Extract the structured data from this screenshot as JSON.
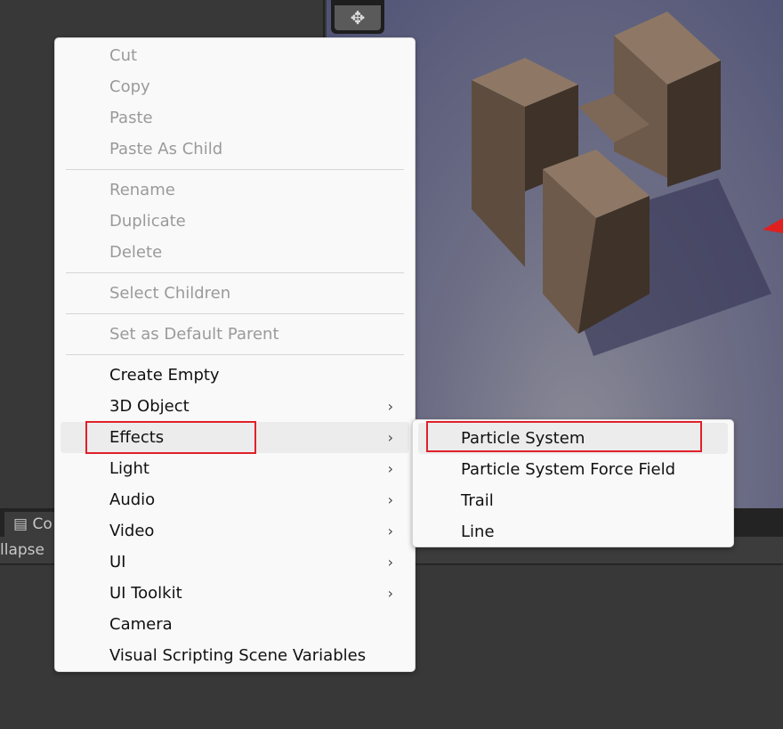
{
  "bottom_panel": {
    "tab_label": "Co",
    "toolbar_text": "llapse"
  },
  "context_menu": {
    "groups": [
      [
        {
          "label": "Cut",
          "enabled": false
        },
        {
          "label": "Copy",
          "enabled": false
        },
        {
          "label": "Paste",
          "enabled": false
        },
        {
          "label": "Paste As Child",
          "enabled": false
        }
      ],
      [
        {
          "label": "Rename",
          "enabled": false
        },
        {
          "label": "Duplicate",
          "enabled": false
        },
        {
          "label": "Delete",
          "enabled": false
        }
      ],
      [
        {
          "label": "Select Children",
          "enabled": false
        }
      ],
      [
        {
          "label": "Set as Default Parent",
          "enabled": false
        }
      ],
      [
        {
          "label": "Create Empty",
          "enabled": true
        },
        {
          "label": "3D Object",
          "enabled": true,
          "submenu": true
        },
        {
          "label": "Effects",
          "enabled": true,
          "submenu": true,
          "highlighted": true
        },
        {
          "label": "Light",
          "enabled": true,
          "submenu": true
        },
        {
          "label": "Audio",
          "enabled": true,
          "submenu": true
        },
        {
          "label": "Video",
          "enabled": true,
          "submenu": true
        },
        {
          "label": "UI",
          "enabled": true,
          "submenu": true
        },
        {
          "label": "UI Toolkit",
          "enabled": true,
          "submenu": true
        },
        {
          "label": "Camera",
          "enabled": true
        },
        {
          "label": "Visual Scripting Scene Variables",
          "enabled": true
        }
      ]
    ]
  },
  "effects_submenu": {
    "items": [
      {
        "label": "Particle System",
        "highlighted": true
      },
      {
        "label": "Particle System Force Field"
      },
      {
        "label": "Trail"
      },
      {
        "label": "Line"
      }
    ]
  },
  "annotation_color": "#e0202a"
}
